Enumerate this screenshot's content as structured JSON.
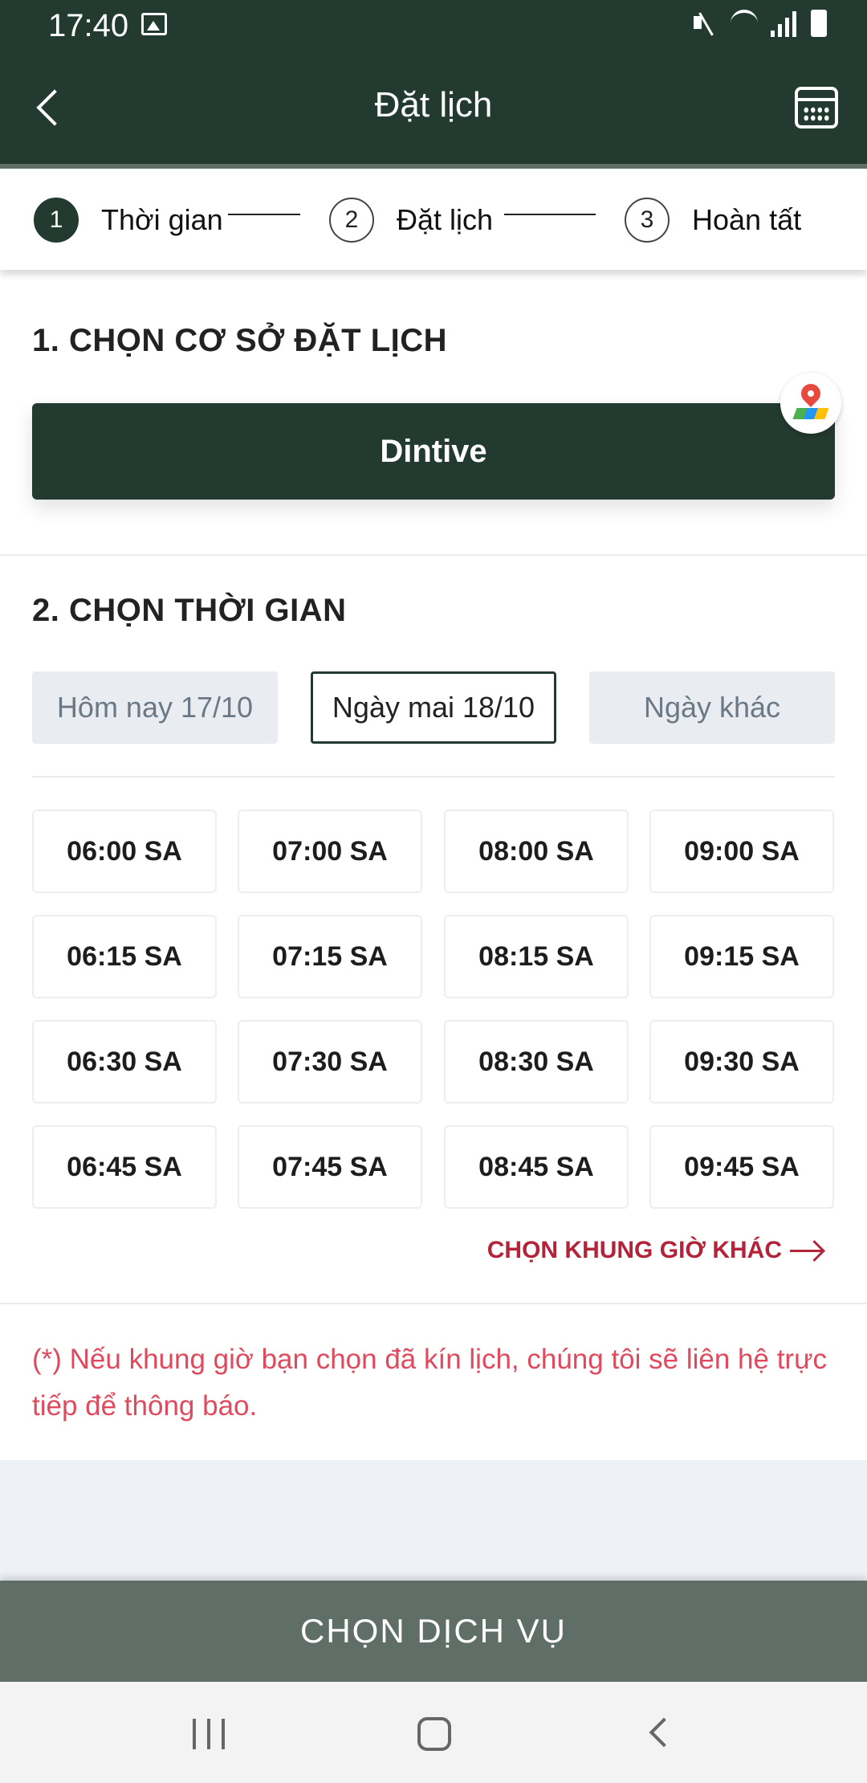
{
  "status_bar": {
    "time": "17:40"
  },
  "app_bar": {
    "title": "Đặt lịch"
  },
  "stepper": {
    "steps": [
      {
        "number": "1",
        "label": "Thời gian"
      },
      {
        "number": "2",
        "label": "Đặt lịch"
      },
      {
        "number": "3",
        "label": "Hoàn tất"
      }
    ]
  },
  "section1": {
    "title": "1. CHỌN CƠ SỞ ĐẶT LỊCH",
    "venue": "Dintive"
  },
  "section2": {
    "title": "2. CHỌN THỜI GIAN",
    "date_tabs": [
      "Hôm nay 17/10",
      "Ngày mai 18/10",
      "Ngày khác"
    ],
    "time_slots": [
      [
        "06:00 SA",
        "07:00 SA",
        "08:00 SA",
        "09:00 SA"
      ],
      [
        "06:15 SA",
        "07:15 SA",
        "08:15 SA",
        "09:15 SA"
      ],
      [
        "06:30 SA",
        "07:30 SA",
        "08:30 SA",
        "09:30 SA"
      ],
      [
        "06:45 SA",
        "07:45 SA",
        "08:45 SA",
        "09:45 SA"
      ]
    ],
    "more_link": "CHỌN KHUNG GIỜ KHÁC"
  },
  "note": "(*) Nếu khung giờ bạn chọn đã kín lịch, chúng tôi sẽ liên hệ trực tiếp để thông báo.",
  "cta": {
    "label": "CHỌN DỊCH VỤ"
  },
  "colors": {
    "primary": "#233a30",
    "accent": "#b3243a",
    "note": "#e04a5e",
    "cta_bg": "#5f6e66"
  }
}
